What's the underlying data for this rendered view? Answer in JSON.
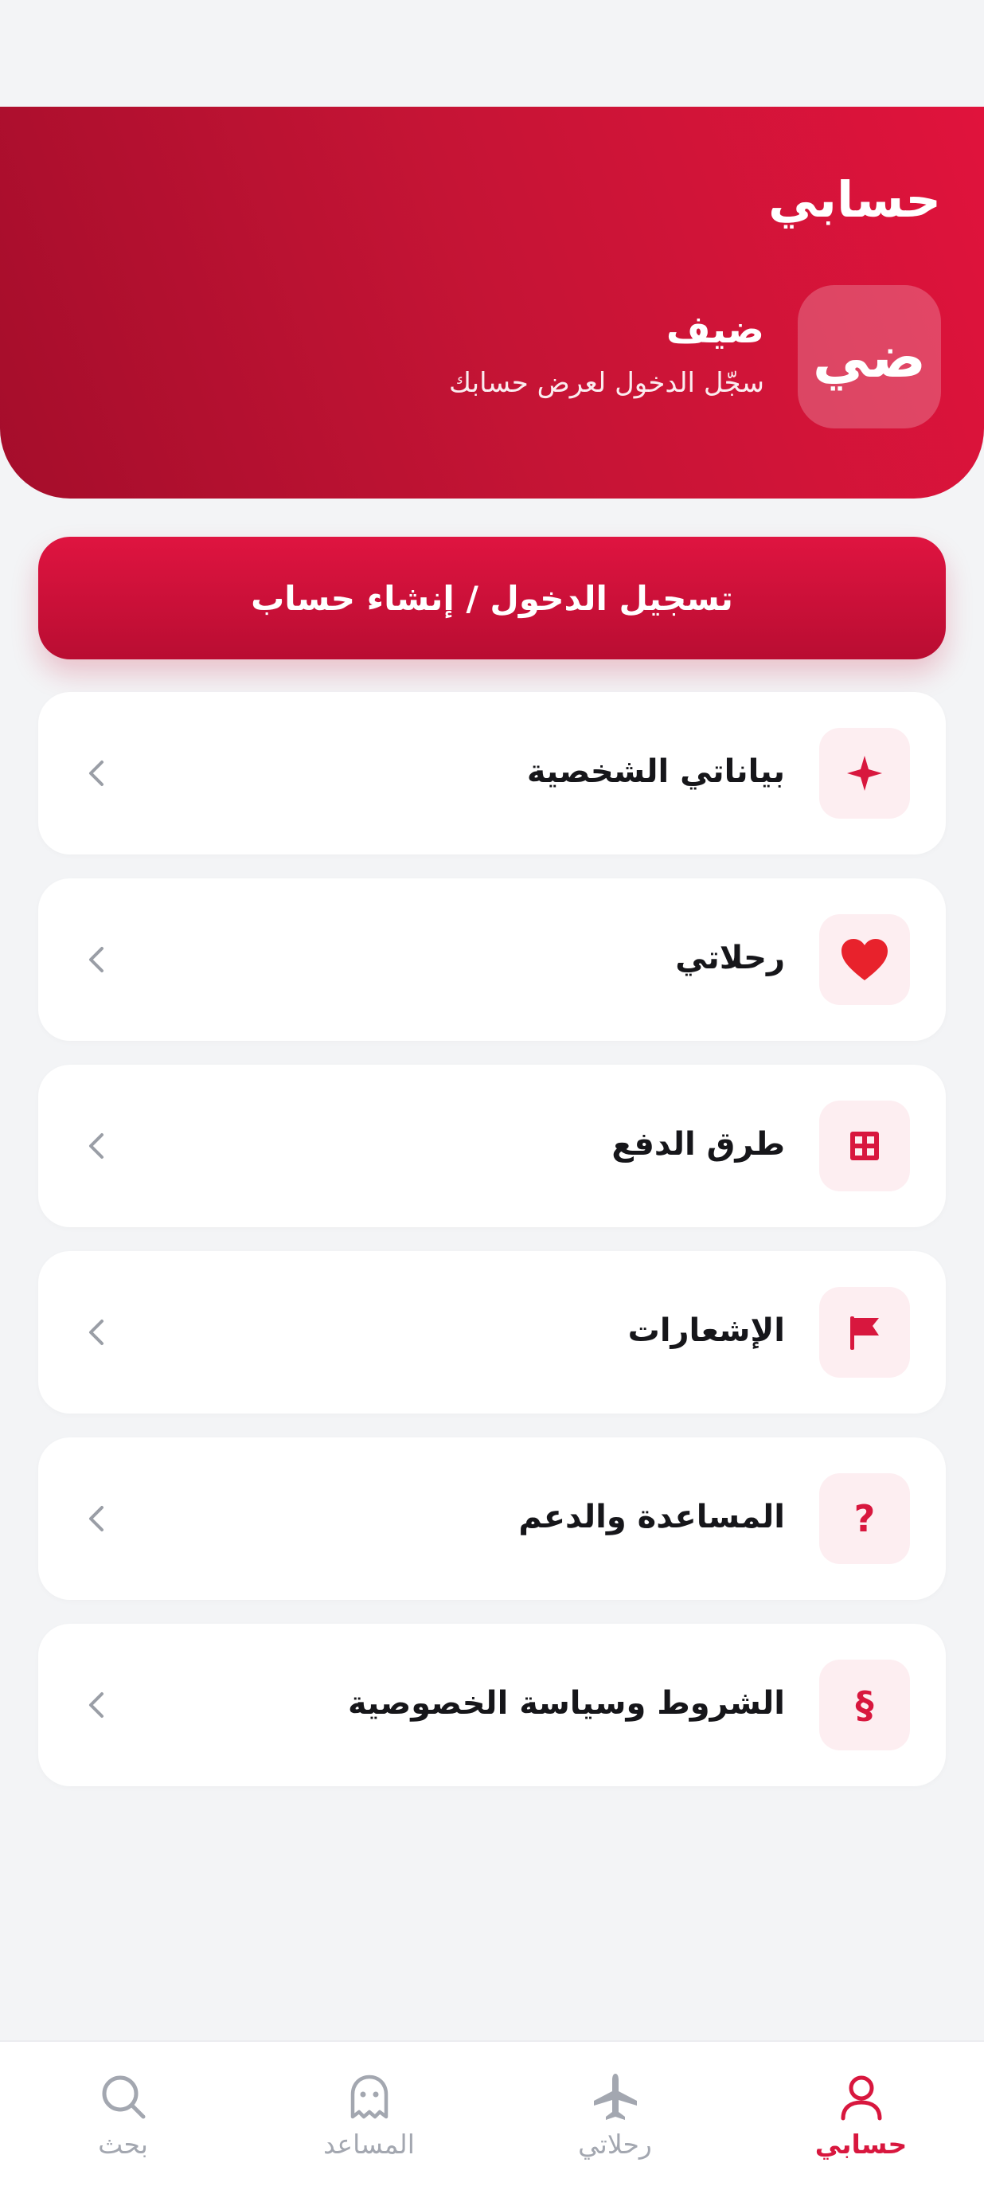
{
  "header": {
    "title": "حسابي",
    "avatar_initials": "ضي",
    "guest_name": "ضيف",
    "guest_subtitle": "سجّل الدخول لعرض حسابك"
  },
  "login_button": {
    "label": "تسجيل الدخول / إنشاء حساب"
  },
  "menu": {
    "items": [
      {
        "label": "بياناتي الشخصية",
        "icon": "sparkle-icon"
      },
      {
        "label": "رحلاتي",
        "icon": "heart-icon"
      },
      {
        "label": "طرق الدفع",
        "icon": "grid-icon"
      },
      {
        "label": "الإشعارات",
        "icon": "flag-icon"
      },
      {
        "label": "المساعدة والدعم",
        "icon": "question-icon",
        "glyph": "?"
      },
      {
        "label": "الشروط وسياسة الخصوصية",
        "icon": "section-sign-icon",
        "glyph": "§"
      }
    ]
  },
  "bottom_nav": {
    "items": [
      {
        "label": "حسابي",
        "icon": "person-icon",
        "active": true
      },
      {
        "label": "رحلاتي",
        "icon": "plane-icon",
        "active": false
      },
      {
        "label": "المساعد",
        "icon": "ghost-icon",
        "active": false
      },
      {
        "label": "بحث",
        "icon": "search-icon",
        "active": false
      }
    ]
  },
  "colors": {
    "accent": "#d8173e",
    "header_gradient_start": "#e0133c",
    "header_gradient_end": "#a50d2b",
    "icon_bg": "#fdeef1",
    "nav_inactive": "#a3a7b0",
    "heart": "#e8222c"
  }
}
